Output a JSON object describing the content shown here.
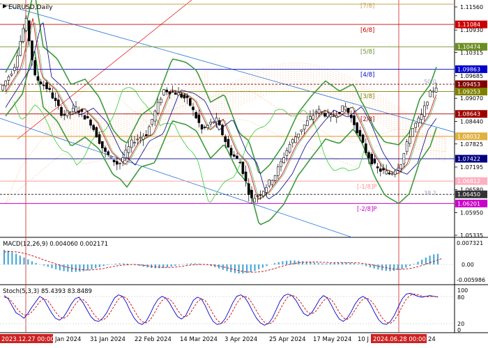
{
  "symbol_title": "EURUSD,Daily",
  "macd": {
    "label": "MACD(12,26,9) 0.004060 0.002171",
    "scale": [
      "0.007321",
      "0.00",
      "-0.005986"
    ],
    "values": [
      0.0055,
      0.0052,
      0.0046,
      0.004,
      0.0033,
      0.0026,
      0.0019,
      0.0012,
      0.0006,
      0.0001,
      -0.0004,
      -0.0009,
      -0.0014,
      -0.0018,
      -0.0022,
      -0.0025,
      -0.0027,
      -0.0028,
      -0.0028,
      -0.0027,
      -0.0025,
      -0.0022,
      -0.0018,
      -0.0014,
      -0.001,
      -0.0006,
      -0.0002,
      0.0001,
      0.0003,
      0.0004,
      0.0004,
      0.0003,
      0.0001,
      -0.0002,
      -0.0005,
      -0.0008,
      -0.0011,
      -0.0013,
      -0.0014,
      -0.0014,
      -0.0013,
      -0.0011,
      -0.0008,
      -0.0005,
      -0.0002,
      0.0001,
      0.0003,
      0.0004,
      0.0004,
      0.0003,
      0.0001,
      -0.0002,
      -0.0006,
      -0.001,
      -0.0015,
      -0.002,
      -0.0025,
      -0.0029,
      -0.0032,
      -0.0034,
      -0.0034,
      -0.0032,
      -0.0029,
      -0.0024,
      -0.0018,
      -0.0012,
      -0.0006,
      0.0,
      0.0005,
      0.0009,
      0.0012,
      0.0014,
      0.0015,
      0.0015,
      0.0014,
      0.0012,
      0.001,
      0.0008,
      0.0006,
      0.0005,
      0.0004,
      0.0004,
      0.0005,
      0.0006,
      0.0007,
      0.0008,
      0.0008,
      0.0007,
      0.0005,
      0.0002,
      -0.0002,
      -0.0006,
      -0.0011,
      -0.0015,
      -0.0019,
      -0.0022,
      -0.0024,
      -0.0025,
      -0.0024,
      -0.0021,
      -0.0017,
      -0.0012,
      -0.0005,
      0.0002,
      0.001,
      0.0018,
      0.0026,
      0.0033,
      0.0038,
      0.004
    ],
    "signal": [
      0.0047,
      0.0048,
      0.0048,
      0.0047,
      0.0045,
      0.0042,
      0.0038,
      0.0033,
      0.0028,
      0.0023,
      0.0017,
      0.0012,
      0.0007,
      0.0002,
      -0.0003,
      -0.0007,
      -0.0011,
      -0.0014,
      -0.0017,
      -0.0019,
      -0.002,
      -0.0021,
      -0.002,
      -0.0019,
      -0.0017,
      -0.0015,
      -0.0012,
      -0.0009,
      -0.0006,
      -0.0004,
      -0.0002,
      -0.0001,
      0.0,
      0.0,
      -0.0001,
      -0.0003,
      -0.0005,
      -0.0007,
      -0.0009,
      -0.001,
      -0.0011,
      -0.0011,
      -0.0011,
      -0.001,
      -0.0008,
      -0.0006,
      -0.0004,
      -0.0002,
      -0.0001,
      0.0,
      0.0,
      0.0,
      -0.0001,
      -0.0003,
      -0.0006,
      -0.0009,
      -0.0012,
      -0.0016,
      -0.0019,
      -0.0023,
      -0.0026,
      -0.0028,
      -0.0029,
      -0.0029,
      -0.0028,
      -0.0026,
      -0.0023,
      -0.0019,
      -0.0015,
      -0.001,
      -0.0006,
      -0.0002,
      0.0001,
      0.0004,
      0.0006,
      0.0008,
      0.0009,
      0.0009,
      0.0009,
      0.0009,
      0.0008,
      0.0008,
      0.0007,
      0.0007,
      0.0007,
      0.0007,
      0.0007,
      0.0007,
      0.0007,
      0.0006,
      0.0004,
      0.0002,
      0.0,
      -0.0003,
      -0.0006,
      -0.0009,
      -0.0012,
      -0.0015,
      -0.0017,
      -0.0018,
      -0.0018,
      -0.0017,
      -0.0015,
      -0.0012,
      -0.0008,
      -0.0004,
      0.0001,
      0.0007,
      0.0012,
      0.0017,
      0.0022
    ]
  },
  "stoch": {
    "label": "Stoch(5,3,3) 85.4393 83.8489",
    "scale": [
      "100",
      "80",
      "20",
      "0"
    ],
    "main": [
      88,
      80,
      62,
      44,
      38,
      30,
      42,
      58,
      72,
      86,
      80,
      62,
      44,
      30,
      25,
      32,
      48,
      66,
      80,
      84,
      70,
      52,
      34,
      24,
      22,
      30,
      44,
      64,
      82,
      90,
      86,
      70,
      48,
      30,
      18,
      14,
      22,
      40,
      62,
      78,
      86,
      82,
      68,
      50,
      34,
      28,
      36,
      56,
      76,
      84,
      80,
      62,
      40,
      22,
      14,
      16,
      28,
      48,
      70,
      86,
      90,
      84,
      68,
      48,
      30,
      18,
      12,
      16,
      30,
      52,
      74,
      88,
      92,
      88,
      76,
      58,
      42,
      36,
      44,
      60,
      78,
      88,
      82,
      64,
      44,
      28,
      22,
      30,
      46,
      66,
      80,
      86,
      80,
      64,
      44,
      26,
      16,
      14,
      22,
      38,
      60,
      80,
      92,
      94,
      90,
      86,
      84,
      86,
      88,
      86,
      85
    ],
    "signal": [
      84,
      82,
      72,
      58,
      46,
      38,
      38,
      46,
      58,
      72,
      80,
      76,
      62,
      46,
      34,
      29,
      35,
      49,
      65,
      77,
      78,
      69,
      52,
      37,
      27,
      25,
      32,
      46,
      63,
      79,
      86,
      82,
      68,
      50,
      33,
      21,
      18,
      25,
      41,
      60,
      75,
      82,
      79,
      67,
      51,
      37,
      33,
      40,
      56,
      72,
      80,
      75,
      60,
      41,
      25,
      17,
      20,
      31,
      49,
      68,
      82,
      87,
      81,
      67,
      49,
      32,
      20,
      15,
      19,
      33,
      52,
      71,
      85,
      89,
      85,
      74,
      59,
      45,
      41,
      47,
      61,
      75,
      83,
      78,
      63,
      45,
      31,
      27,
      35,
      51,
      67,
      79,
      82,
      75,
      63,
      45,
      29,
      19,
      17,
      25,
      41,
      61,
      79,
      89,
      92,
      90,
      87,
      85,
      86,
      86,
      84
    ]
  },
  "price_axis": [
    "1.11560",
    "1.10930",
    "1.10315",
    "1.09685",
    "1.09070",
    "1.08440",
    "1.07825",
    "1.07195",
    "1.06580",
    "1.05950",
    "1.05335"
  ],
  "levels": [
    {
      "label": "[7/8]",
      "price": "",
      "color": "#c8a050",
      "bg": ""
    },
    {
      "label": "[6/8]",
      "price": "1.11084",
      "color": "#cc0000",
      "bg": "#cc0000"
    },
    {
      "label": "[5/8]",
      "price": "1.10474",
      "color": "#6b8e23",
      "bg": "#6b8e23"
    },
    {
      "label": "[4/8]",
      "price": "1.09863",
      "color": "#0000cc",
      "bg": "#0000cc"
    },
    {
      "label": "",
      "price": "1.09453",
      "color": "#800000",
      "bg": "#800000"
    },
    {
      "label": "[3/8]",
      "price": "1.09253",
      "color": "#808000",
      "bg": "#808000"
    },
    {
      "label": "[2/8]",
      "price": "1.08643",
      "color": "#a00000",
      "bg": "#a00000"
    },
    {
      "label": "",
      "price": "1.08032",
      "color": "#e08000",
      "bg": "#e0b040"
    },
    {
      "label": "",
      "price": "1.07422",
      "color": "#000080",
      "bg": "#000080"
    },
    {
      "label": "[-1/8]P",
      "price": "1.06812",
      "color": "#ff9090",
      "bg": "#ffb0c0"
    },
    {
      "label": "",
      "price": "1.06450",
      "color": "#333333",
      "bg": "#333333"
    },
    {
      "label": "[-2/8]P",
      "price": "1.06201",
      "color": "#cc00cc",
      "bg": "#cc00cc"
    }
  ],
  "fib_labels": [
    "50.0",
    "38.2"
  ],
  "time_axis": [
    "2023.12.27 00:00",
    "Jan 2024",
    "31 Jan 2024",
    "22 Feb 2024",
    "14 Mar 2024",
    "3 Apr 2024",
    "25 Apr 2024",
    "17 May 2024",
    "10 J",
    "2024.06.28 00:00",
    "24"
  ],
  "colors": {
    "candle": "#000000",
    "bollinger": "#3c9a3c",
    "fast_ma": "#cc0000",
    "slow_ma": "#00008b",
    "ichimoku_cloud": "#f0a060",
    "chikou": "#33cc33",
    "macd_hist": "#4aa8d8",
    "macd_signal": "#cc0000",
    "stoch_main": "#0000cc",
    "stoch_signal": "#cc0000",
    "channel": "#1e6fd9"
  }
}
